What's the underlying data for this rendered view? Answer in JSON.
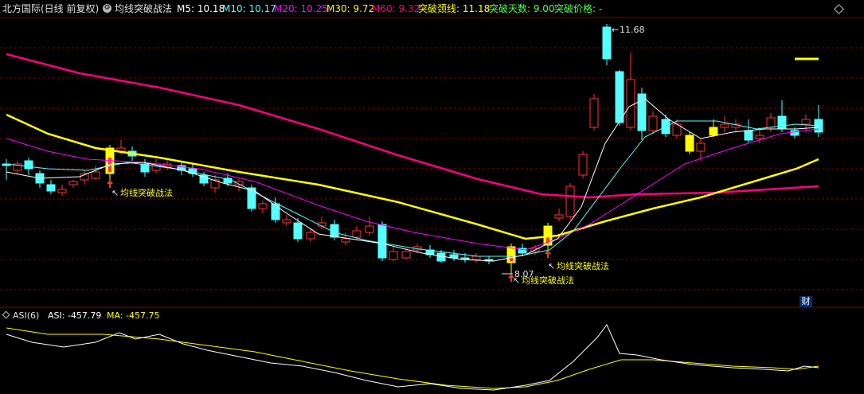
{
  "header": {
    "title": "北方国际(日线 前复权)",
    "indicator_name": "均线突破战法",
    "ma5": "M5: 10.18",
    "ma10": "M10: 10.17",
    "ma20": "M20: 10.25",
    "ma30": "M30: 9.72",
    "ma60": "M60: 9.32",
    "neckline": "突破颈线: 11.18",
    "days": "突破天数: 9.00",
    "price": "突破价格: -"
  },
  "annotations": {
    "high_label": "11.68",
    "low_label": "8.07",
    "signal_1": "均线突破战法",
    "signal_2": "均线突破战法",
    "signal_3": "均线突破战法"
  },
  "sub_header": {
    "name": "ASI(6)",
    "asi": "ASI: -457.79",
    "ma": "MA: -457.75"
  },
  "badge": {
    "label": "财"
  },
  "colors": {
    "up": "#ff3232",
    "down": "#54ffff",
    "signal": "#ffff00",
    "ma5": "#ffffff",
    "ma10": "#54ffff",
    "ma20": "#ff00ff",
    "ma30": "#ffff00",
    "ma60": "#ff0080",
    "grid": "#800000",
    "asi": "#ffffff",
    "asi_ma": "#ffff00"
  },
  "icons": [
    "gear-icon",
    "diamond-icon",
    "arrow-up-icon"
  ]
}
